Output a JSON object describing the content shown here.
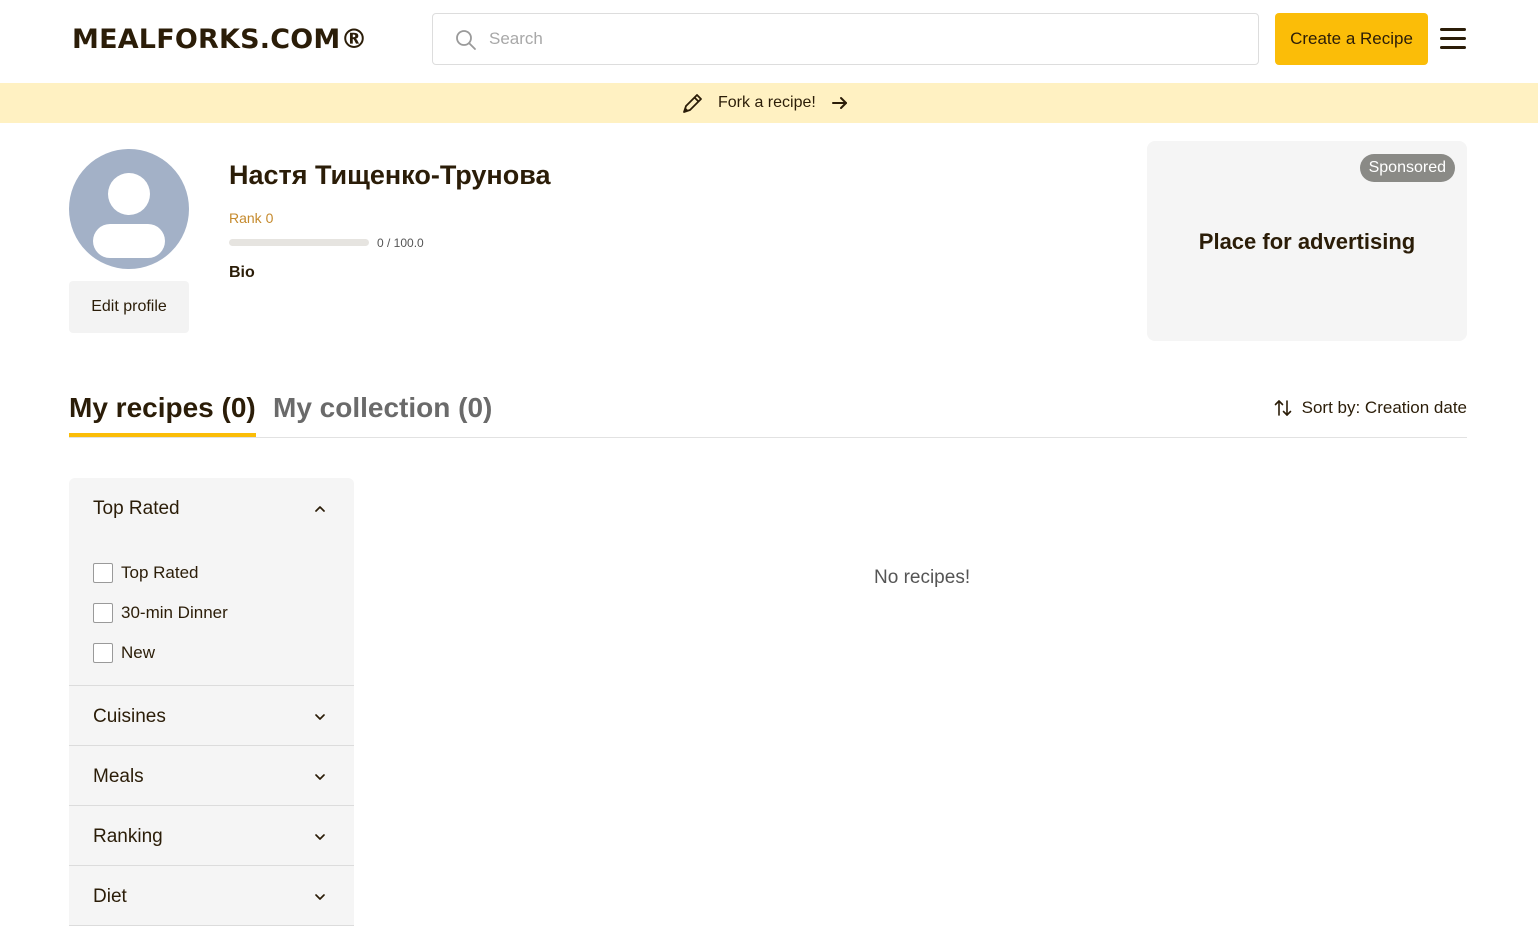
{
  "header": {
    "logo_text": "MEALFORKS.COM®",
    "search_placeholder": "Search",
    "create_button_label": "Create a Recipe",
    "accent_color": "#fbbd08"
  },
  "banner": {
    "text": "Fork a recipe!",
    "icon": "pencil-icon",
    "arrow_icon": "arrow-right-icon",
    "background_color": "#fff1c2"
  },
  "profile": {
    "name": "Настя Тищенко-Трунова",
    "rank_label": "Rank 0",
    "rank_progress_text": "0 / 100.0",
    "rank_progress_fraction": 0.0,
    "bio_label": "Bio",
    "edit_button_label": "Edit profile"
  },
  "ad": {
    "badge": "Sponsored",
    "text": "Place for advertising"
  },
  "tabs": [
    {
      "label": "My recipes (0)",
      "active": true
    },
    {
      "label": "My collection (0)",
      "active": false
    }
  ],
  "sort": {
    "label": "Sort by: Creation date",
    "icon": "sort-arrows-icon"
  },
  "filters": {
    "sections": [
      {
        "label": "Top Rated",
        "expanded": true,
        "options": [
          "Top Rated",
          "30-min Dinner",
          "New"
        ]
      },
      {
        "label": "Cuisines",
        "expanded": false
      },
      {
        "label": "Meals",
        "expanded": false
      },
      {
        "label": "Ranking",
        "expanded": false
      },
      {
        "label": "Diet",
        "expanded": false
      }
    ]
  },
  "main": {
    "empty_text": "No recipes!"
  }
}
